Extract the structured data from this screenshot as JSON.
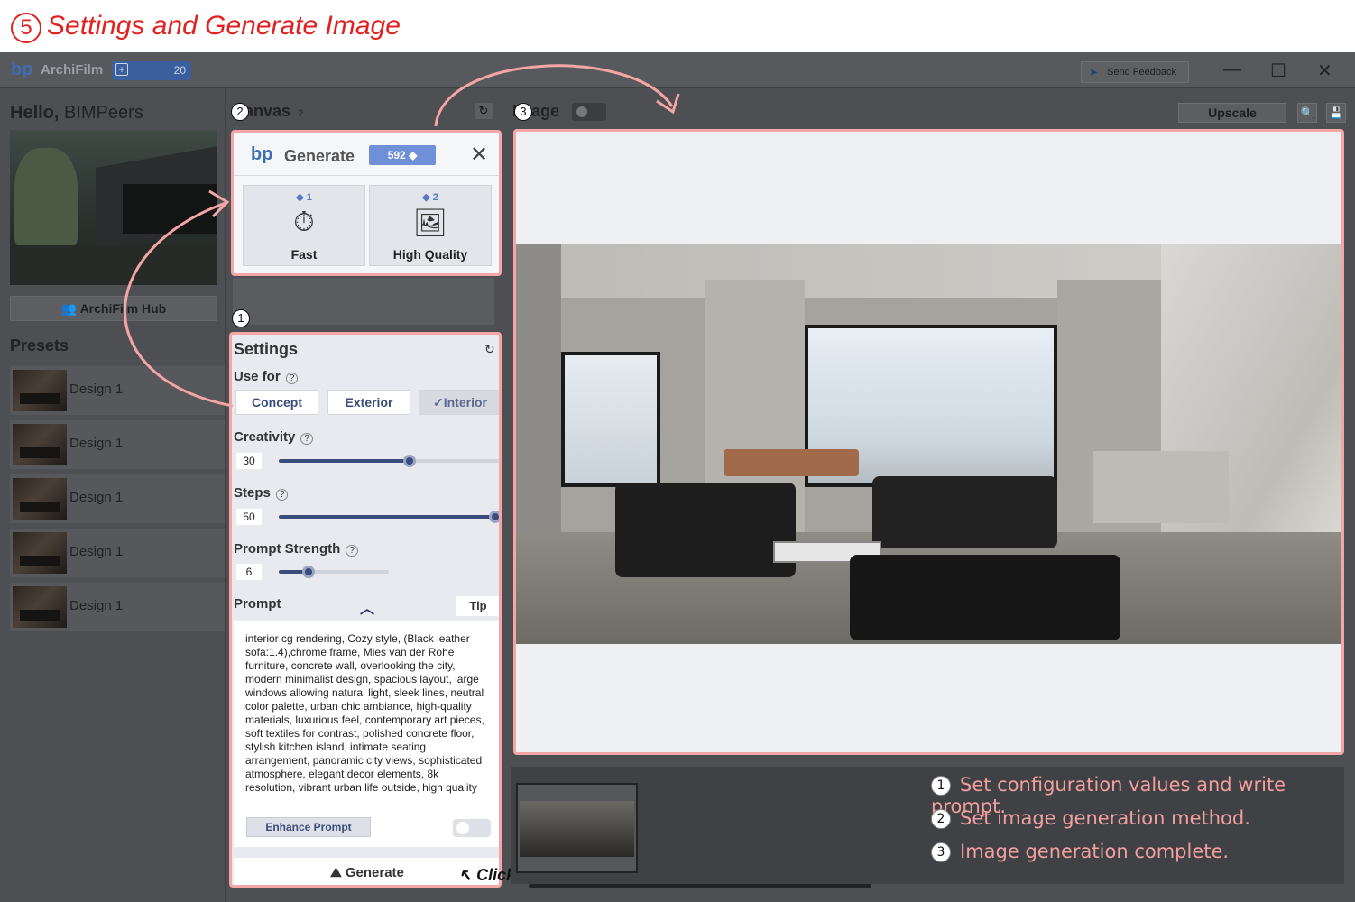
{
  "banner": {
    "step": "5",
    "title": "Settings and Generate Image"
  },
  "titlebar": {
    "logo": "bp",
    "app_name": "ArchiFilm",
    "plus": "+",
    "credits": "20",
    "feedback": "Send Feedback",
    "minimize": "—",
    "maximize": "☐",
    "close": "✕"
  },
  "left": {
    "greeting": "Hello,",
    "user": "BIMPeers",
    "hub_button": "ArchiFilm Hub",
    "presets_title": "Presets",
    "presets": [
      "Design 1",
      "Design 1",
      "Design 1",
      "Design 1",
      "Design 1"
    ]
  },
  "canvas": {
    "title": "Canvas",
    "help": "?",
    "refresh": "↻"
  },
  "generate_panel": {
    "logo": "bp",
    "title": "Generate",
    "credits": "592",
    "close": "✕",
    "options": [
      {
        "cost": "1",
        "label": "Fast",
        "icon": "stopwatch-icon"
      },
      {
        "cost": "2",
        "label": "High Quality",
        "icon": "gallery-icon"
      }
    ]
  },
  "settings": {
    "title": "Settings",
    "refresh": "↻",
    "use_for_label": "Use for",
    "help": "?",
    "use_for": [
      "Concept",
      "Exterior",
      "Interior"
    ],
    "use_for_selected": "Interior",
    "creativity_label": "Creativity",
    "creativity": "30",
    "steps_label": "Steps",
    "steps": "50",
    "prompt_strength_label": "Prompt Strength",
    "prompt_strength": "6",
    "prompt_label": "Prompt",
    "tip": "Tip",
    "prompt_text": "interior cg rendering, Cozy style, (Black leather sofa:1.4),chrome frame, Mies van der Rohe furniture, concrete wall, overlooking the city, modern minimalist design, spacious layout, large windows allowing natural light, sleek lines, neutral color palette, urban chic ambiance, high-quality materials, luxurious feel, contemporary art pieces, soft textiles for contrast, polished concrete floor, stylish kitchen island, intimate seating arrangement, panoramic city views, sophisticated atmosphere, elegant decor elements, 8k resolution, vibrant urban life outside, high quality",
    "enhance_prompt": "Enhance Prompt",
    "generate": "Generate",
    "click_hint": "Click"
  },
  "image": {
    "title": "Image",
    "upscale": "Upscale"
  },
  "notes": [
    {
      "num": "1",
      "text": "Set configuration values and write prompt."
    },
    {
      "num": "2",
      "text": "Set image generation method."
    },
    {
      "num": "3",
      "text": "Image generation complete."
    }
  ],
  "markers": [
    "1",
    "2",
    "3"
  ],
  "colors": {
    "annotation": "#f29f9f",
    "banner": "#e32020",
    "accent": "#3f6db3"
  }
}
